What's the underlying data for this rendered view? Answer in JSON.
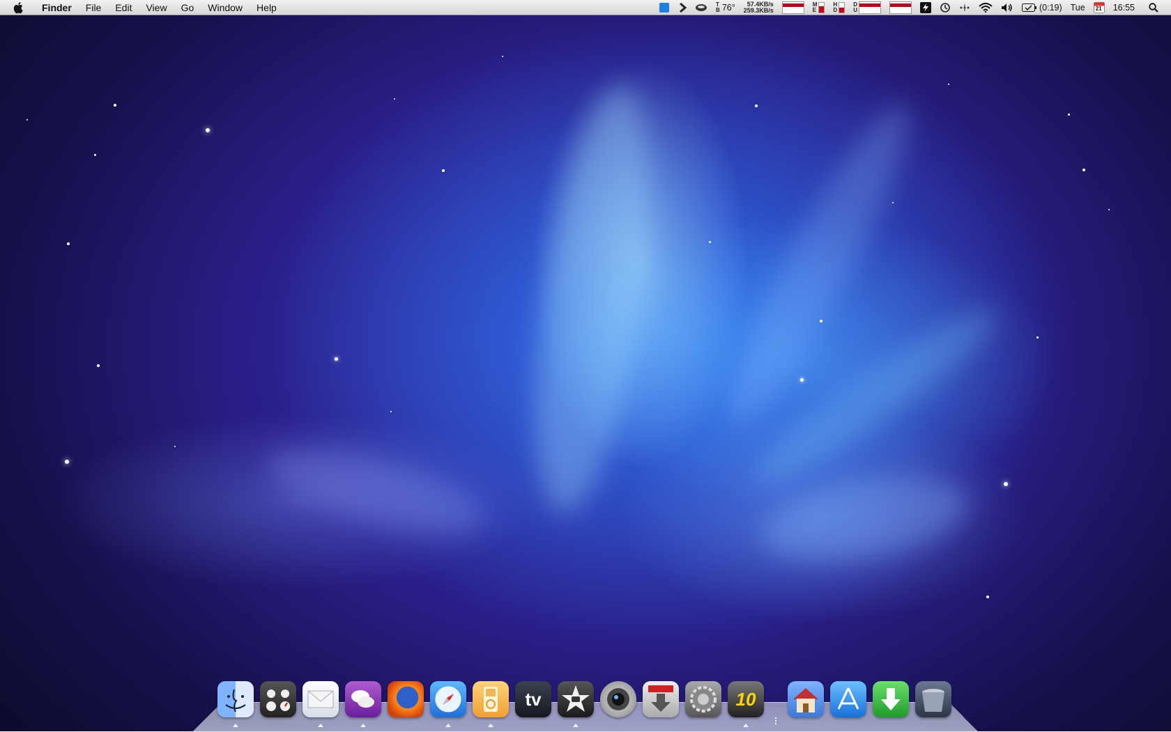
{
  "menubar": {
    "app_name": "Finder",
    "menus": [
      "File",
      "Edit",
      "View",
      "Go",
      "Window",
      "Help"
    ],
    "temperature": "76°",
    "net_up": "57.4KB/s",
    "net_down": "259.3KB/s",
    "battery_time": "(0:19)",
    "day": "Tue",
    "calendar_date": "21",
    "time": "16:55"
  },
  "dock": {
    "apps": [
      {
        "name": "Finder",
        "icon": "finder-icon",
        "running": true
      },
      {
        "name": "iStat Menus",
        "icon": "dashboard-icon",
        "running": false
      },
      {
        "name": "Mail",
        "icon": "mail-icon",
        "running": true
      },
      {
        "name": "Adium",
        "icon": "chat-icon",
        "running": true
      },
      {
        "name": "Firefox",
        "icon": "firefox-icon",
        "running": false
      },
      {
        "name": "Safari",
        "icon": "safari-icon",
        "running": true
      },
      {
        "name": "iTunes",
        "icon": "ipod-icon",
        "running": true
      },
      {
        "name": "TV",
        "icon": "tv-icon",
        "label": "tv",
        "running": false
      },
      {
        "name": "iMovie",
        "icon": "imovie-star-icon",
        "running": true
      },
      {
        "name": "Camera",
        "icon": "camera-lens-icon",
        "running": false
      },
      {
        "name": "Transmission",
        "icon": "download-arrow-icon",
        "running": false
      },
      {
        "name": "System Preferences",
        "icon": "gear-icon",
        "running": false
      },
      {
        "name": "Game",
        "icon": "game-10-icon",
        "label": "10",
        "running": true
      }
    ],
    "stacks": [
      {
        "name": "Home",
        "icon": "home-icon"
      },
      {
        "name": "App Store",
        "icon": "app-store-icon"
      },
      {
        "name": "Downloads",
        "icon": "downloads-icon"
      },
      {
        "name": "Trash",
        "icon": "trash-icon"
      }
    ]
  }
}
